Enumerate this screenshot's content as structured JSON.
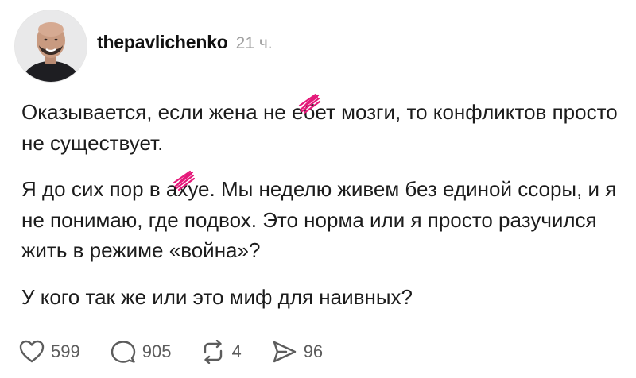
{
  "post": {
    "username": "thepavlichenko",
    "time": "21 ч.",
    "paragraphs": [
      {
        "before": "Оказывается, если жена не е",
        "censored": "б",
        "after": "ет мозги, то конфликтов просто не существует."
      },
      {
        "before": "Я до сих пор в а",
        "censored": "х",
        "after": "уе. Мы неделю живем без единой ссоры, и я не понимаю, где подвох. Это норма или я просто разучился жить в режиме «война»?"
      },
      {
        "text": "У кого так же или это миф для наивных?"
      }
    ]
  },
  "actions": {
    "likes": "599",
    "comments": "905",
    "reposts": "4",
    "shares": "96"
  },
  "colors": {
    "censor_scribble": "#e5197a",
    "muted_text": "#a0a0a0",
    "icon": "#5c5c5c"
  }
}
